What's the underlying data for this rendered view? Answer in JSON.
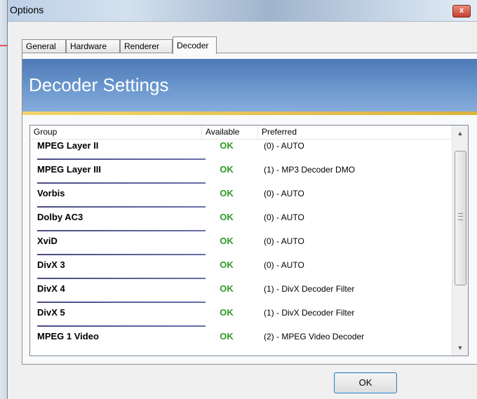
{
  "window": {
    "title": "Options",
    "close_label": "x"
  },
  "tabs": [
    {
      "label": "General"
    },
    {
      "label": "Hardware"
    },
    {
      "label": "Renderer"
    },
    {
      "label": "Decoder"
    }
  ],
  "banner": {
    "heading": "Decoder Settings"
  },
  "list": {
    "columns": {
      "group": "Group",
      "available": "Available",
      "preferred": "Preferred"
    },
    "rows": [
      {
        "group": "MPEG Layer II",
        "available": "OK",
        "preferred": "(0) - AUTO"
      },
      {
        "group": "MPEG Layer III",
        "available": "OK",
        "preferred": "(1) - MP3 Decoder DMO"
      },
      {
        "group": "Vorbis",
        "available": "OK",
        "preferred": "(0) - AUTO"
      },
      {
        "group": "Dolby AC3",
        "available": "OK",
        "preferred": "(0) - AUTO"
      },
      {
        "group": "XviD",
        "available": "OK",
        "preferred": "(0) - AUTO"
      },
      {
        "group": "DivX 3",
        "available": "OK",
        "preferred": "(0) - AUTO"
      },
      {
        "group": "DivX 4",
        "available": "OK",
        "preferred": "(1) - DivX Decoder Filter"
      },
      {
        "group": "DivX 5",
        "available": "OK",
        "preferred": "(1) - DivX Decoder Filter"
      },
      {
        "group": "MPEG 1 Video",
        "available": "OK",
        "preferred": "(2) - MPEG Video Decoder"
      }
    ]
  },
  "scrollbar": {
    "up_arrow": "▲",
    "down_arrow": "▼"
  },
  "footer": {
    "ok_label": "OK"
  },
  "colors": {
    "banner": "#5b86c2",
    "accent_stripe": "#e8c14e",
    "available_ok": "#2d9a27"
  }
}
